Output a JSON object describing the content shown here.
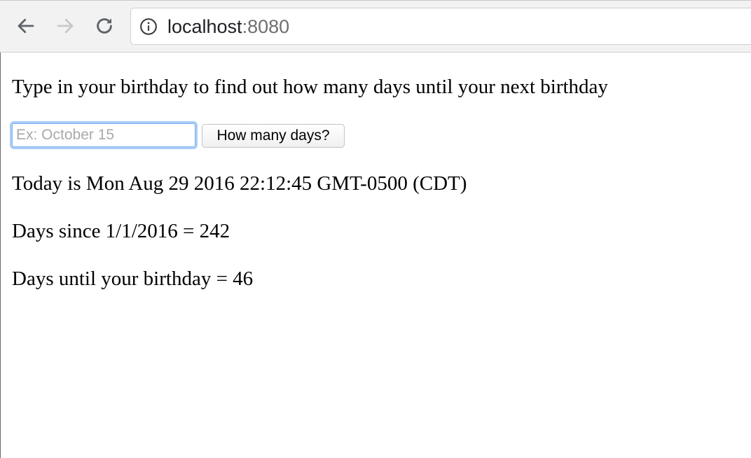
{
  "browser": {
    "url_host": "localhost",
    "url_port": ":8080",
    "icons": {
      "back": "arrow-left-icon",
      "forward": "arrow-right-icon",
      "reload": "reload-icon",
      "site_info": "info-icon"
    }
  },
  "page": {
    "prompt": "Type in your birthday to find out how many days until your next birthday",
    "input_placeholder": "Ex: October 15",
    "input_value": "",
    "button_label": "How many days?",
    "today_line": "Today is Mon Aug 29 2016 22:12:45 GMT-0500 (CDT)",
    "days_since_line": "Days since 1/1/2016 = 242",
    "days_until_line": "Days until your birthday = 46"
  },
  "colors": {
    "focus_ring": "#a9cdf7",
    "toolbar_bg": "#f2f2f2",
    "forward_disabled": "#c8c8c8"
  }
}
